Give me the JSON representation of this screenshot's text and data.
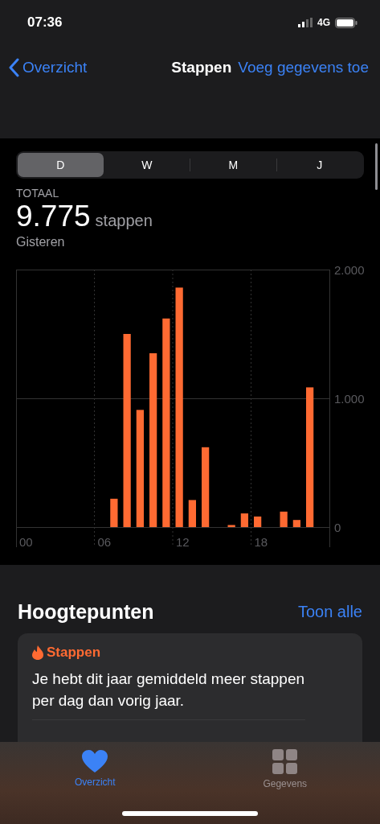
{
  "status_bar": {
    "time": "07:36",
    "network": "4G"
  },
  "nav": {
    "back": "Overzicht",
    "title": "Stappen",
    "action": "Voeg gegevens toe"
  },
  "segments": [
    {
      "label": "D",
      "selected": true
    },
    {
      "label": "W",
      "selected": false
    },
    {
      "label": "M",
      "selected": false
    },
    {
      "label": "J",
      "selected": false
    }
  ],
  "summary": {
    "caption": "TOTAAL",
    "value": "9.775",
    "unit": "stappen",
    "period": "Gisteren"
  },
  "chart_data": {
    "type": "bar",
    "color": "#ff6a32",
    "grid": true,
    "x": [
      0,
      1,
      2,
      3,
      4,
      5,
      6,
      7,
      8,
      9,
      10,
      11,
      12,
      13,
      14,
      15,
      16,
      17,
      18,
      19,
      20,
      21,
      22,
      23
    ],
    "values": [
      0,
      0,
      0,
      0,
      0,
      0,
      0,
      220,
      1500,
      910,
      1350,
      1620,
      1860,
      210,
      620,
      0,
      16,
      106,
      82,
      0,
      120,
      55,
      1085,
      0
    ],
    "xlim": [
      -0.5,
      23.5
    ],
    "ylim": [
      0,
      2000
    ],
    "yticks": [
      {
        "value": 0,
        "label": "0"
      },
      {
        "value": 1000,
        "label": "1.000"
      },
      {
        "value": 2000,
        "label": "2.000"
      }
    ],
    "xticks": [
      {
        "value": 0,
        "label": "00"
      },
      {
        "value": 6,
        "label": "06"
      },
      {
        "value": 12,
        "label": "12"
      },
      {
        "value": 18,
        "label": "18"
      }
    ]
  },
  "highlights": {
    "title": "Hoogtepunten",
    "link": "Toon alle",
    "card": {
      "category": "Stappen",
      "text": "Je hebt dit jaar gemiddeld meer stappen per dag dan vorig jaar."
    }
  },
  "tab_bar": [
    {
      "label": "Overzicht",
      "kind": "heart",
      "selected": true
    },
    {
      "label": "Gegevens",
      "kind": "grid",
      "selected": false
    }
  ]
}
